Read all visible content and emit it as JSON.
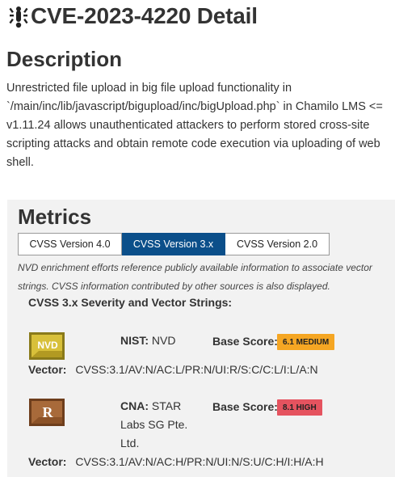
{
  "header": {
    "icon": "bug-icon",
    "title": "CVE-2023-4220 Detail"
  },
  "description": {
    "heading": "Description",
    "text": "Unrestricted file upload in big file upload functionality in `/main/inc/lib/javascript/bigupload/inc/bigUpload.php` in Chamilo LMS <= v1.11.24 allows unauthenticated attackers to perform stored cross-site scripting attacks and obtain remote code execution via uploading of web shell."
  },
  "metrics": {
    "heading": "Metrics",
    "tabs": [
      {
        "label": "CVSS Version 4.0",
        "active": false
      },
      {
        "label": "CVSS Version 3.x",
        "active": true
      },
      {
        "label": "CVSS Version 2.0",
        "active": false
      }
    ],
    "note": "NVD enrichment efforts reference publicly available information to associate vector strings. CVSS information contributed by other sources is also displayed.",
    "severity_heading": "CVSS 3.x Severity and Vector Strings:",
    "entries": [
      {
        "logo": "nvd-logo-icon",
        "logo_text": "NVD",
        "source_label": "NIST:",
        "source_value": "NVD",
        "base_score_label": "Base Score:",
        "base_score": "6.1 MEDIUM",
        "badge_color": "#f5a623",
        "vector_label": "Vector:",
        "vector": "CVSS:3.1/AV:N/AC:L/PR:N/UI:R/S:C/C:L/I:L/A:N"
      },
      {
        "logo": "cna-logo-icon",
        "logo_text": "R",
        "source_label": "CNA:",
        "source_value": "STAR Labs SG Pte. Ltd.",
        "base_score_label": "Base Score:",
        "base_score": "8.1 HIGH",
        "badge_color": "#e5535f",
        "vector_label": "Vector:",
        "vector": "CVSS:3.1/AV:N/AC:H/PR:N/UI:N/S:U/C:H/I:H/A:H"
      }
    ]
  }
}
